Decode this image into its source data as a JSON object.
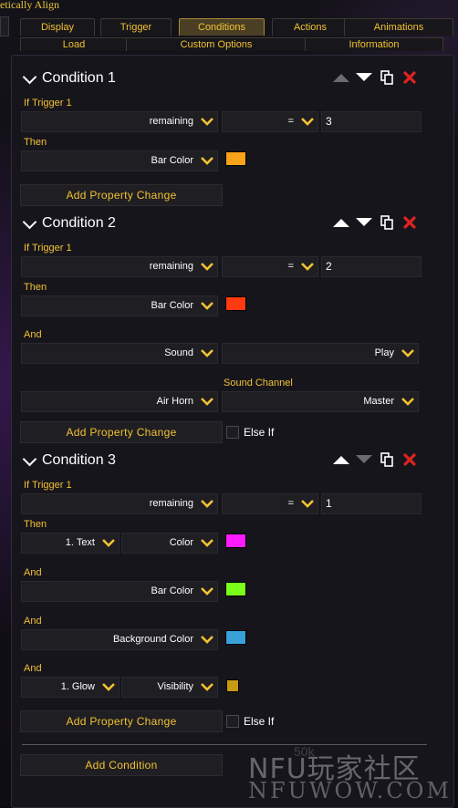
{
  "window_title": "etically Align",
  "tabs_row1": [
    "Display",
    "Trigger",
    "Conditions",
    "Actions",
    "Animations"
  ],
  "tabs_row2": [
    "Load",
    "Custom Options",
    "Information"
  ],
  "active_tab": "Conditions",
  "colors": {
    "accent": "#f1c232",
    "delete": "#e0231f"
  },
  "conditions": [
    {
      "title": "Condition 1",
      "if_label": "If Trigger 1",
      "check": {
        "property": "remaining",
        "operator": "=",
        "value": "3"
      },
      "then_label": "Then",
      "then": {
        "property": "Bar Color",
        "color": "#f7a21b"
      },
      "add_property_label": "Add Property Change"
    },
    {
      "title": "Condition 2",
      "if_label": "If Trigger 1",
      "check": {
        "property": "remaining",
        "operator": "=",
        "value": "2"
      },
      "then_label": "Then",
      "then": {
        "property": "Bar Color",
        "color": "#ff3a10"
      },
      "and_label": "And",
      "and1": {
        "property": "Sound",
        "value": "Play"
      },
      "sound_channel_label": "Sound Channel",
      "sound": {
        "file": "Air Horn",
        "channel": "Master"
      },
      "add_property_label": "Add Property Change",
      "else_if_label": "Else If"
    },
    {
      "title": "Condition 3",
      "if_label": "If Trigger 1",
      "check": {
        "property": "remaining",
        "operator": "=",
        "value": "1"
      },
      "then_label": "Then",
      "then": {
        "target": "1. Text",
        "property": "Color",
        "color": "#ff1aff"
      },
      "and_label": "And",
      "and1": {
        "property": "Bar Color",
        "color": "#7aff1a"
      },
      "and2": {
        "property": "Background Color",
        "color": "#3aa0d8"
      },
      "and3": {
        "target": "1. Glow",
        "property": "Visibility",
        "color": "#c89b14"
      },
      "add_property_label": "Add Property Change",
      "else_if_label": "Else If"
    }
  ],
  "add_condition_label": "Add Condition",
  "watermark": {
    "line1": "NFU玩家社区",
    "line2": "NFUWOW.COM",
    "faint": "50k"
  }
}
